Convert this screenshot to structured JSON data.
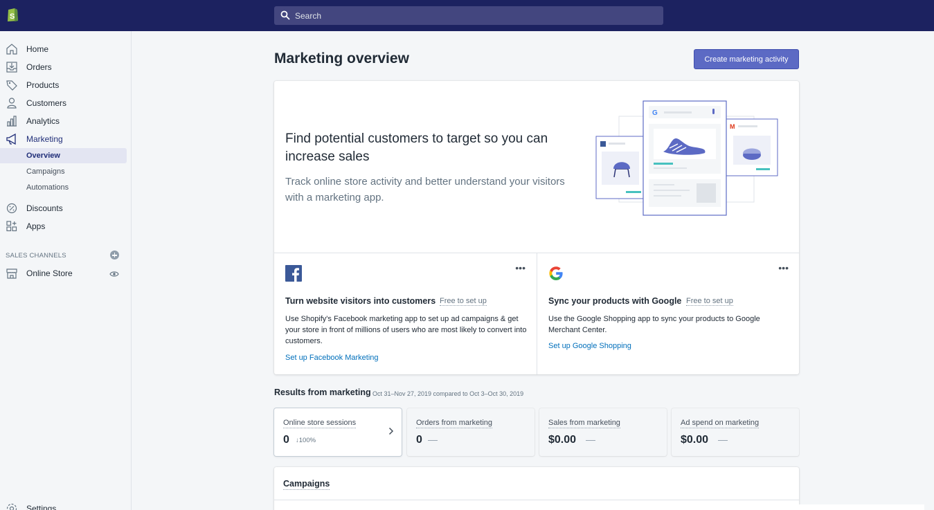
{
  "topbar": {
    "search_placeholder": "Search",
    "color": "#1c2260"
  },
  "sidebar": {
    "items": [
      {
        "label": "Home",
        "icon": "home-icon"
      },
      {
        "label": "Orders",
        "icon": "orders-icon"
      },
      {
        "label": "Products",
        "icon": "tag-icon"
      },
      {
        "label": "Customers",
        "icon": "person-icon"
      },
      {
        "label": "Analytics",
        "icon": "bar-chart-icon"
      },
      {
        "label": "Marketing",
        "icon": "megaphone-icon"
      },
      {
        "label": "Discounts",
        "icon": "discount-icon"
      },
      {
        "label": "Apps",
        "icon": "apps-icon"
      }
    ],
    "marketing_sub": [
      {
        "label": "Overview"
      },
      {
        "label": "Campaigns"
      },
      {
        "label": "Automations"
      }
    ],
    "sales_channels_label": "SALES CHANNELS",
    "online_store_label": "Online Store",
    "settings_label": "Settings"
  },
  "main": {
    "title": "Marketing overview",
    "create_button": "Create marketing activity",
    "hero": {
      "title": "Find potential customers to target so you can increase sales",
      "subtitle": "Track online store activity and better understand your visitors with a marketing app."
    },
    "apps": [
      {
        "icon": "facebook-icon",
        "title": "Turn website visitors into customers",
        "badge": "Free to set up",
        "description": "Use Shopify's Facebook marketing app to set up ad campaigns & get your store in front of millions of users who are most likely to convert into customers.",
        "link": "Set up Facebook Marketing",
        "more": "•••"
      },
      {
        "icon": "google-icon",
        "title": "Sync your products with Google",
        "badge": "Free to set up",
        "description": "Use the Google Shopping app to sync your products to Google Merchant Center.",
        "link": "Set up Google Shopping",
        "more": "•••"
      }
    ],
    "results": {
      "title": "Results from marketing",
      "date_range": "Oct 31–Nov 27, 2019 compared to Oct 3–Oct 30, 2019",
      "metrics": [
        {
          "label": "Online store sessions",
          "value": "0",
          "delta": "↓100%"
        },
        {
          "label": "Orders from marketing",
          "value": "0",
          "delta": "—"
        },
        {
          "label": "Sales from marketing",
          "value": "$0.00",
          "delta": "—"
        },
        {
          "label": "Ad spend on marketing",
          "value": "$0.00",
          "delta": "—"
        }
      ]
    },
    "campaigns_title": "Campaigns"
  },
  "colors": {
    "accent": "#5c6ac4",
    "link": "#006fbb",
    "sidebar_active": "#202e78"
  }
}
